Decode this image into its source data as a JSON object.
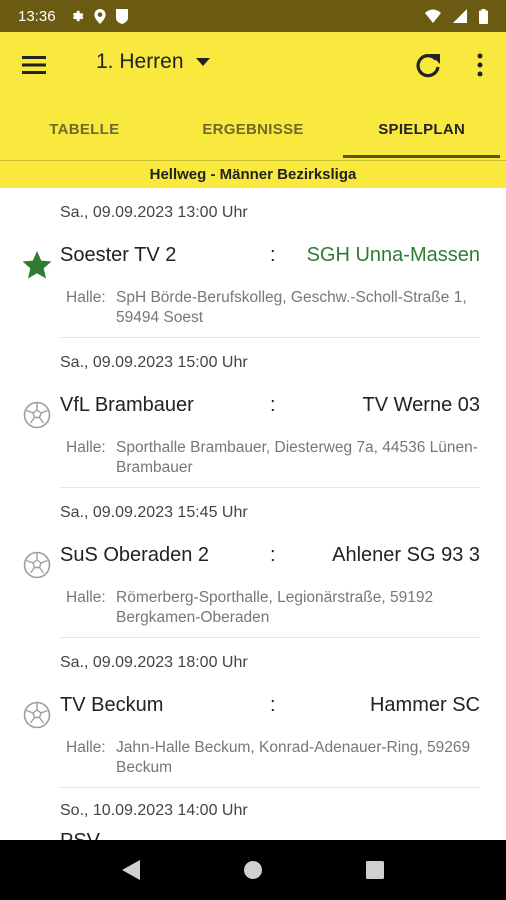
{
  "status_bar": {
    "time": "13:36"
  },
  "app_bar": {
    "title": "1. Herren"
  },
  "tabs": [
    {
      "label": "TABELLE",
      "active": false
    },
    {
      "label": "ERGEBNISSE",
      "active": false
    },
    {
      "label": "SPIELPLAN",
      "active": true
    }
  ],
  "league": "Hellweg - Männer Bezirksliga",
  "hall_label": "Halle:",
  "separator": ":",
  "matches": [
    {
      "date": "Sa., 09.09.2023 13:00 Uhr",
      "home": "Soester TV 2",
      "away": "SGH Unna-Massen",
      "hall": "SpH Börde-Berufskolleg, Geschw.-Scholl-Straße 1, 59494 Soest",
      "icon": "star-icon"
    },
    {
      "date": "Sa., 09.09.2023 15:00 Uhr",
      "home": "VfL Brambauer",
      "away": "TV Werne 03",
      "hall": "Sporthalle Brambauer, Diesterweg 7a, 44536 Lünen-Brambauer",
      "icon": "ball-icon"
    },
    {
      "date": "Sa., 09.09.2023 15:45 Uhr",
      "home": "SuS Oberaden 2",
      "away": "Ahlener SG 93 3",
      "hall": "Römerberg-Sporthalle, Legionärstraße, 59192 Bergkamen-Oberaden",
      "icon": "ball-icon"
    },
    {
      "date": "Sa., 09.09.2023 18:00 Uhr",
      "home": "TV Beckum",
      "away": "Hammer SC",
      "hall": "Jahn-Halle Beckum, Konrad-Adenauer-Ring, 59269 Beckum",
      "icon": "ball-icon"
    }
  ],
  "partial_match": {
    "date": "So., 10.09.2023 14:00 Uhr",
    "home": "PSV"
  },
  "colors": {
    "accent": "#f9e93f",
    "status_bar": "#6b5a12",
    "highlight": "#2e7d32"
  }
}
